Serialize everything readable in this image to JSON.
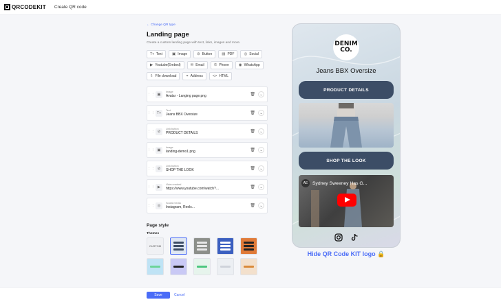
{
  "app": {
    "logo": "QRCODEKIT",
    "crumb": "Create QR code"
  },
  "editor": {
    "back_link": "← Change QR type",
    "title": "Landing page",
    "subtitle": "Create a custom landing page with text, links, images and more.",
    "chips": [
      {
        "icon": "Tт",
        "label": "Text"
      },
      {
        "icon": "▣",
        "label": "Image"
      },
      {
        "icon": "⊘",
        "label": "Button"
      },
      {
        "icon": "▤",
        "label": "PDF"
      },
      {
        "icon": "◎",
        "label": "Social"
      },
      {
        "icon": "▶",
        "label": "Youtube(Embed)"
      },
      {
        "icon": "✉",
        "label": "Email"
      },
      {
        "icon": "✆",
        "label": "Phone"
      },
      {
        "icon": "◉",
        "label": "WhatsApp"
      },
      {
        "icon": "⇩",
        "label": "File download"
      },
      {
        "icon": "⌖",
        "label": "Address"
      },
      {
        "icon": "<>",
        "label": "HTML"
      }
    ],
    "blocks": [
      {
        "icon": "▣",
        "label": "Image",
        "value": "Avatar - Langing page.png"
      },
      {
        "icon": "Tт",
        "label": "Text",
        "value": "Jeans BBX Oversize"
      },
      {
        "icon": "⊘",
        "label": "Link button",
        "value": "PRODUCT DETAILS"
      },
      {
        "icon": "▣",
        "label": "Image",
        "value": "landing-demo1.png"
      },
      {
        "icon": "⊘",
        "label": "Link button",
        "value": "SHOP THE LOOK"
      },
      {
        "icon": "▶",
        "label": "Video embed",
        "value": "https://www.youtube.com/watch?..."
      },
      {
        "icon": "◎",
        "label": "Social media",
        "value": "Instagram, Reels..."
      }
    ],
    "style_title": "Page style",
    "themes_label": "Themes",
    "custom_label": "CUSTOM"
  },
  "footer": {
    "save": "Save",
    "cancel": "Cancel"
  },
  "preview": {
    "logo_line1": "DENIM",
    "logo_line2": "CO.",
    "brand_name": "Jeans BBX Oversize",
    "button1": "PRODUCT DETAILS",
    "button2": "SHOP THE LOOK",
    "video_channel": "AE",
    "video_title": "Sydney Sweeney Has G...",
    "hide_logo": "Hide QR Code KIT logo 🔒"
  },
  "colors": {
    "accent": "#4a6cf7",
    "phone_button": "#3c4d66"
  }
}
